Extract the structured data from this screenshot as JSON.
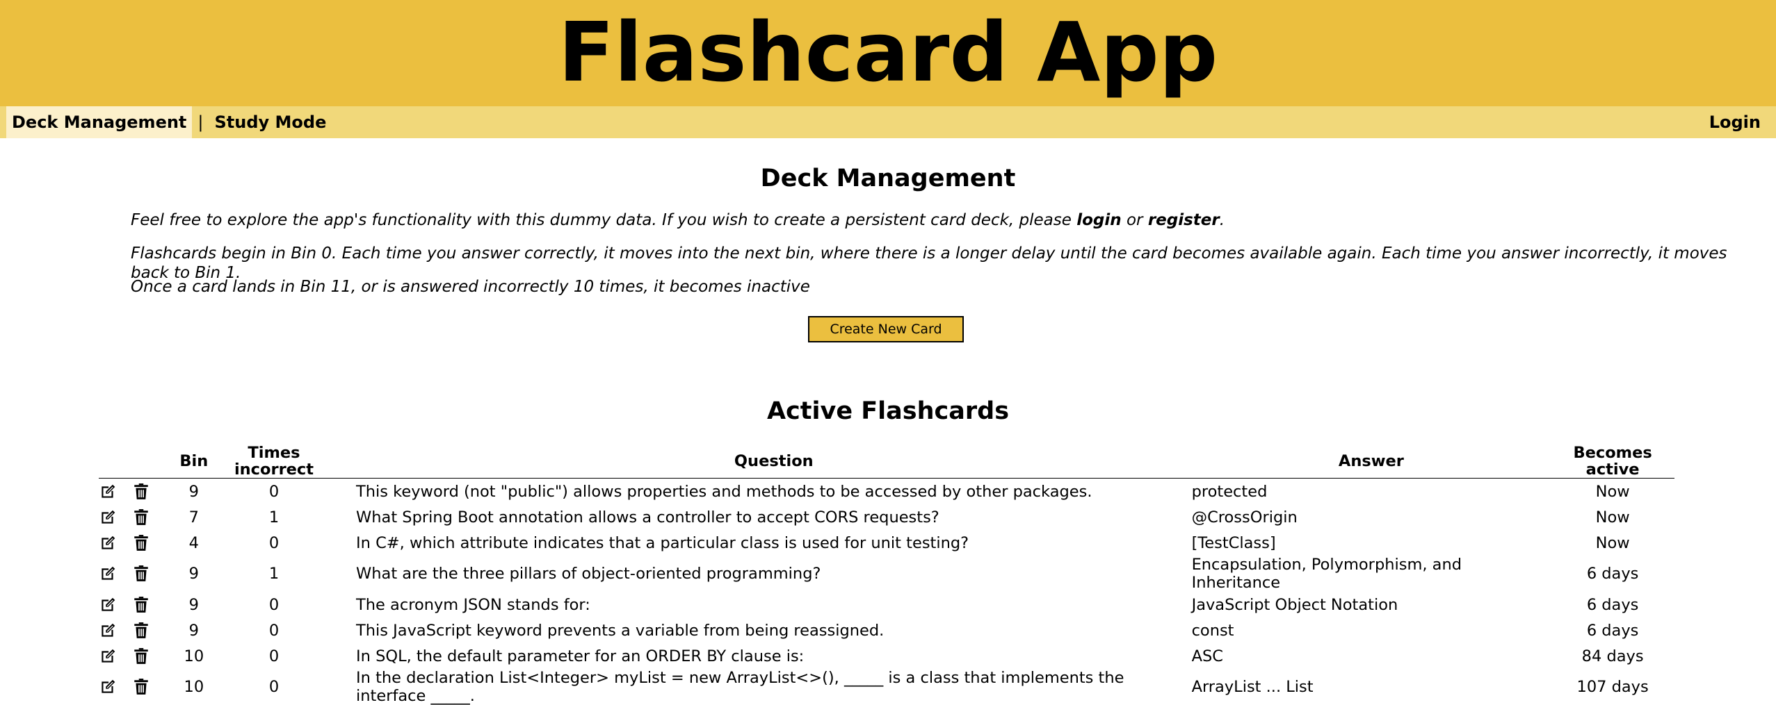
{
  "app": {
    "title": "Flashcard App"
  },
  "nav": {
    "deck_management": "Deck Management",
    "separator": "|",
    "study_mode": "Study Mode",
    "login": "Login"
  },
  "deck": {
    "heading": "Deck Management",
    "intro1_pre": "Feel free to explore the app's functionality with this dummy data. If you wish to create a persistent card deck, please ",
    "intro1_login": "login",
    "intro1_or": " or ",
    "intro1_register": "register",
    "intro1_end": ".",
    "intro2": "Flashcards begin in Bin 0. Each time you answer correctly, it moves into the next bin, where there is a longer delay until the card becomes available again. Each time you answer incorrectly, it moves back to Bin 1.",
    "intro3": "Once a card lands in Bin 11, or is answered incorrectly 10 times, it becomes inactive",
    "create_button": "Create New Card"
  },
  "active": {
    "heading": "Active Flashcards",
    "columns": {
      "bin": "Bin",
      "times_incorrect": "Times incorrect",
      "question": "Question",
      "answer": "Answer",
      "becomes_active": "Becomes active"
    },
    "rows": [
      {
        "bin": "9",
        "incorrect": "0",
        "question": "This keyword (not \"public\") allows properties and methods to be accessed by other packages.",
        "answer": "protected",
        "active": "Now"
      },
      {
        "bin": "7",
        "incorrect": "1",
        "question": "What Spring Boot annotation allows a controller to accept CORS requests?",
        "answer": "@CrossOrigin",
        "active": "Now"
      },
      {
        "bin": "4",
        "incorrect": "0",
        "question": "In C#, which attribute indicates that a particular class is used for unit testing?",
        "answer": "[TestClass]",
        "active": "Now"
      },
      {
        "bin": "9",
        "incorrect": "1",
        "question": "What are the three pillars of object-oriented programming?",
        "answer": "Encapsulation, Polymorphism, and Inheritance",
        "active": "6 days"
      },
      {
        "bin": "9",
        "incorrect": "0",
        "question": "The acronym JSON stands for:",
        "answer": "JavaScript Object Notation",
        "active": "6 days"
      },
      {
        "bin": "9",
        "incorrect": "0",
        "question": "This JavaScript keyword prevents a variable from being reassigned.",
        "answer": "const",
        "active": "6 days"
      },
      {
        "bin": "10",
        "incorrect": "0",
        "question": "In SQL, the default parameter for an ORDER BY clause is:",
        "answer": "ASC",
        "active": "84 days"
      },
      {
        "bin": "10",
        "incorrect": "0",
        "question": "In the declaration List<Integer> myList = new ArrayList<>(), _____ is a class that implements the interface _____.",
        "answer": "ArrayList ... List",
        "active": "107 days"
      }
    ]
  },
  "icons": {
    "edit": "edit-icon",
    "delete": "trash-icon"
  }
}
